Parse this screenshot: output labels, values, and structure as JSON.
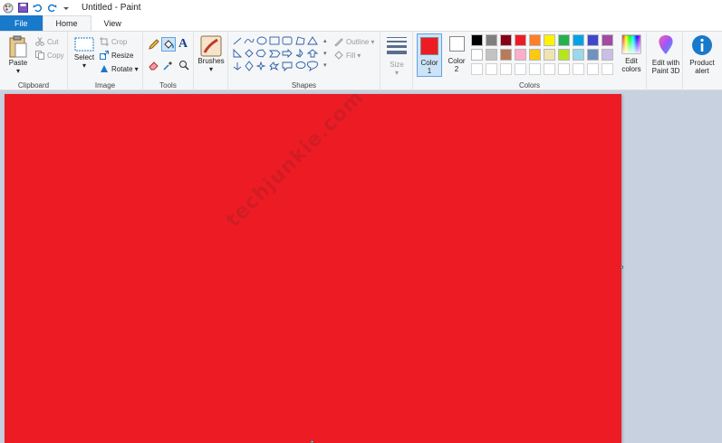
{
  "window": {
    "title": "Untitled - Paint"
  },
  "tabs": [
    {
      "label": "File"
    },
    {
      "label": "Home"
    },
    {
      "label": "View"
    }
  ],
  "clipboard": {
    "paste_label": "Paste",
    "cut_label": "Cut",
    "copy_label": "Copy",
    "group_label": "Clipboard"
  },
  "image": {
    "select_label": "Select",
    "crop_label": "Crop",
    "resize_label": "Resize",
    "rotate_label": "Rotate",
    "group_label": "Image"
  },
  "tools": {
    "group_label": "Tools",
    "text_glyph": "A"
  },
  "brushes": {
    "label": "Brushes"
  },
  "shapes": {
    "outline_label": "Outline",
    "fill_label": "Fill",
    "group_label": "Shapes"
  },
  "size": {
    "label": "Size"
  },
  "colors": {
    "color1_label": "Color",
    "color1_num": "1",
    "color2_label": "Color",
    "color2_num": "2",
    "color1_value": "#ed1c24",
    "color2_value": "#ffffff",
    "edit_colors_line1": "Edit",
    "edit_colors_line2": "colors",
    "group_label": "Colors",
    "palette_row1": [
      "#000000",
      "#7f7f7f",
      "#880015",
      "#ed1c24",
      "#ff7f27",
      "#fff200",
      "#22b14c",
      "#00a2e8",
      "#3f48cc",
      "#a349a4"
    ],
    "palette_row2": [
      "#ffffff",
      "#c3c3c3",
      "#b97a57",
      "#ffaec9",
      "#ffc90e",
      "#efe4b0",
      "#b5e61d",
      "#99d9ea",
      "#7092be",
      "#c8bfe7"
    ]
  },
  "paint3d": {
    "line1": "Edit with",
    "line2": "Paint 3D"
  },
  "alert": {
    "line1": "Product",
    "line2": "alert"
  },
  "canvas": {
    "background": "#ed1c24",
    "watermark": "techjunkie.com"
  }
}
